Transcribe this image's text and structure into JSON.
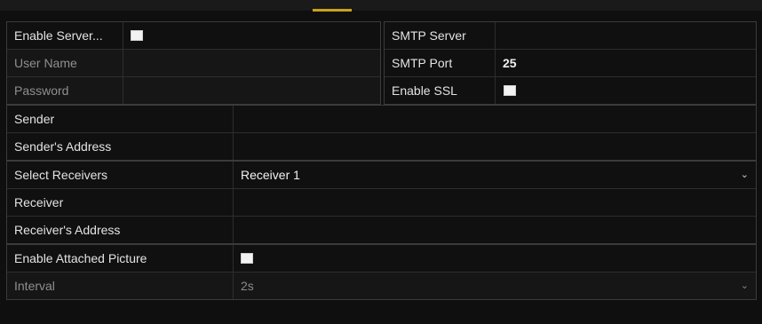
{
  "server": {
    "enable_server_label": "Enable Server...",
    "enable_server_checked": true,
    "user_name_label": "User Name",
    "user_name_value": "",
    "password_label": "Password",
    "password_value": ""
  },
  "smtp": {
    "server_label": "SMTP Server",
    "server_value": "",
    "port_label": "SMTP Port",
    "port_value": "25",
    "ssl_label": "Enable SSL",
    "ssl_checked": true
  },
  "sender": {
    "name_label": "Sender",
    "name_value": "",
    "address_label": "Sender's Address",
    "address_value": ""
  },
  "receivers": {
    "select_label": "Select Receivers",
    "select_value": "Receiver 1",
    "receiver_label": "Receiver",
    "receiver_value": "",
    "address_label": "Receiver's Address",
    "address_value": ""
  },
  "attachment": {
    "picture_label": "Enable Attached Picture",
    "picture_checked": true,
    "interval_label": "Interval",
    "interval_value": "2s"
  },
  "colors": {
    "accent": "#c9a21b",
    "background": "#0f0f0f",
    "border": "#3b3b3b"
  },
  "icons": {
    "dropdown": "chevron-down-icon",
    "checkbox": "checkbox-icon"
  }
}
